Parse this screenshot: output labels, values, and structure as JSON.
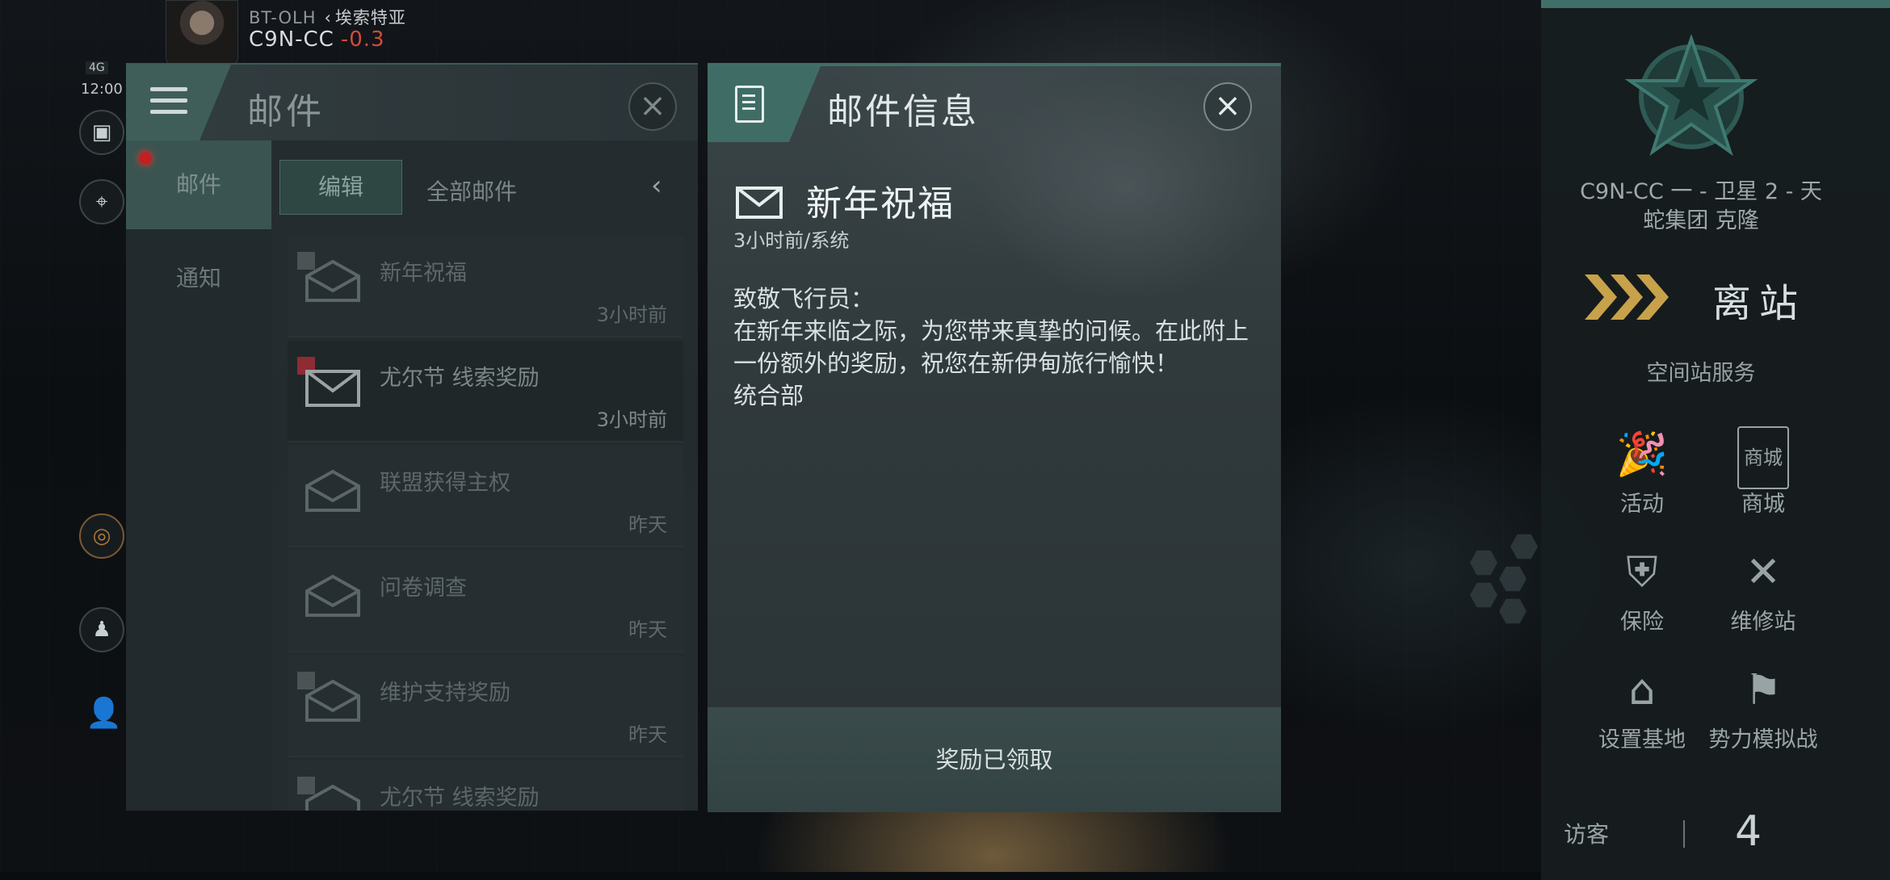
{
  "pilot": {
    "region_system": "BT-OLH",
    "region_name": "埃索特亚",
    "current_system": "C9N-CC",
    "security": "-0.3",
    "network": "4G",
    "time": "12:00"
  },
  "mail_panel": {
    "title": "邮件",
    "side_tabs": [
      "邮件",
      "通知"
    ],
    "edit_label": "编辑",
    "filter_label": "全部邮件",
    "messages": [
      {
        "subject": "新年祝福",
        "time": "3小时前"
      },
      {
        "subject": "尤尔节 线索奖励",
        "time": "3小时前"
      },
      {
        "subject": "联盟获得主权",
        "time": "昨天"
      },
      {
        "subject": "问卷调查",
        "time": "昨天"
      },
      {
        "subject": "维护支持奖励",
        "time": "昨天"
      },
      {
        "subject": "尤尔节 线索奖励",
        "time": ""
      }
    ]
  },
  "mail_info": {
    "title": "邮件信息",
    "subject": "新年祝福",
    "meta": "3小时前/系统",
    "greeting": "致敬飞行员：",
    "body": "在新年来临之际，为您带来真挚的问候。在此附上一份额外的奖励，祝您在新伊甸旅行愉快！",
    "signature": "统合部",
    "claim_status": "奖励已领取"
  },
  "station": {
    "name_line1": "C9N-CC 一 - 卫星 2 - 天",
    "name_line2": "蛇集团 克隆",
    "undock_label": "离站",
    "services_title": "空间站服务",
    "services": [
      {
        "label": "活动",
        "icon": "party-popper-icon"
      },
      {
        "label": "商城",
        "icon": "shop-star-icon"
      },
      {
        "label": "保险",
        "icon": "insurance-shield-icon"
      },
      {
        "label": "维修站",
        "icon": "repair-tools-icon"
      },
      {
        "label": "设置基地",
        "icon": "set-home-icon"
      },
      {
        "label": "势力模拟战",
        "icon": "crossed-flags-icon"
      }
    ],
    "shop_icon_text": "商城",
    "visitors_label": "访客",
    "visitors_count": "4"
  },
  "colors": {
    "accent_teal": "#3f6f68",
    "security_red": "#d24a3b",
    "undock_gold": "#c8a24a"
  }
}
